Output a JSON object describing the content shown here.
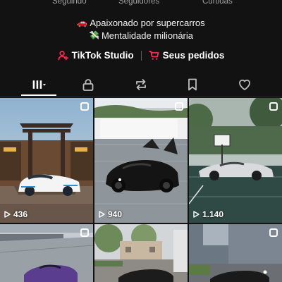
{
  "profile": {
    "stats": {
      "following_label": "Seguindo",
      "followers_label": "Seguidores",
      "likes_label": "Curtidas"
    },
    "bio": [
      {
        "emoji": "🚗",
        "text": "Apaixonado por supercarros"
      },
      {
        "emoji": "💸",
        "text": "Mentalidade milionária"
      }
    ],
    "links": {
      "studio_label": "TikTok Studio",
      "orders_label": "Seus pedidos",
      "accent_color": "#fe2c55"
    }
  },
  "tabs": [
    {
      "icon": "grid-icon",
      "active": true
    },
    {
      "icon": "lock-icon",
      "active": false
    },
    {
      "icon": "repost-icon",
      "active": false
    },
    {
      "icon": "bookmark-icon",
      "active": false
    },
    {
      "icon": "heart-icon",
      "active": false
    }
  ],
  "videos": [
    {
      "views": "436",
      "subject": "white Bugatti Divo at Japanese shrine gate"
    },
    {
      "views": "940",
      "subject": "black Ferrari LaFerrari with open doors"
    },
    {
      "views": "1.140",
      "subject": "silver Ferrari Enzo on basketball court"
    },
    {
      "views": "",
      "subject": "purple supercar on rooftop"
    },
    {
      "views": "",
      "subject": "supercar in front of house"
    },
    {
      "views": "",
      "subject": "supercar by modern building"
    }
  ]
}
